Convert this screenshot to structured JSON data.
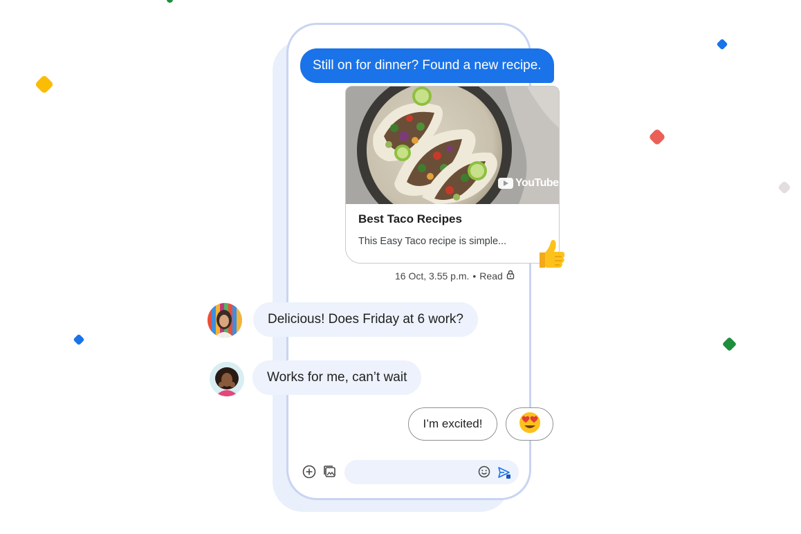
{
  "colors": {
    "outgoing_bubble": "#1a73e8",
    "incoming_bubble": "#edf2fc",
    "phone_border": "#c9d4f2",
    "phone_shadow": "#e9effb"
  },
  "conversation": {
    "outgoing_message": "Still on for dinner? Found a new recipe.",
    "link_preview": {
      "source_logo_text": "YouTube",
      "title": "Best Taco Recipes",
      "description": "This Easy Taco recipe is simple..."
    },
    "reaction_emoji": "👍",
    "meta": {
      "timestamp": "16 Oct, 3.55 p.m.",
      "separator": "•",
      "status": "Read"
    },
    "incoming_messages": [
      {
        "text": "Delicious! Does Friday at 6 work?"
      },
      {
        "text": "Works for me, can’t wait"
      }
    ]
  },
  "suggestions": {
    "reply": "I’m excited!",
    "emoji": "😍"
  },
  "compose": {
    "icons": [
      "plus-icon",
      "gallery-icon",
      "emoji-icon",
      "send-icon"
    ]
  }
}
